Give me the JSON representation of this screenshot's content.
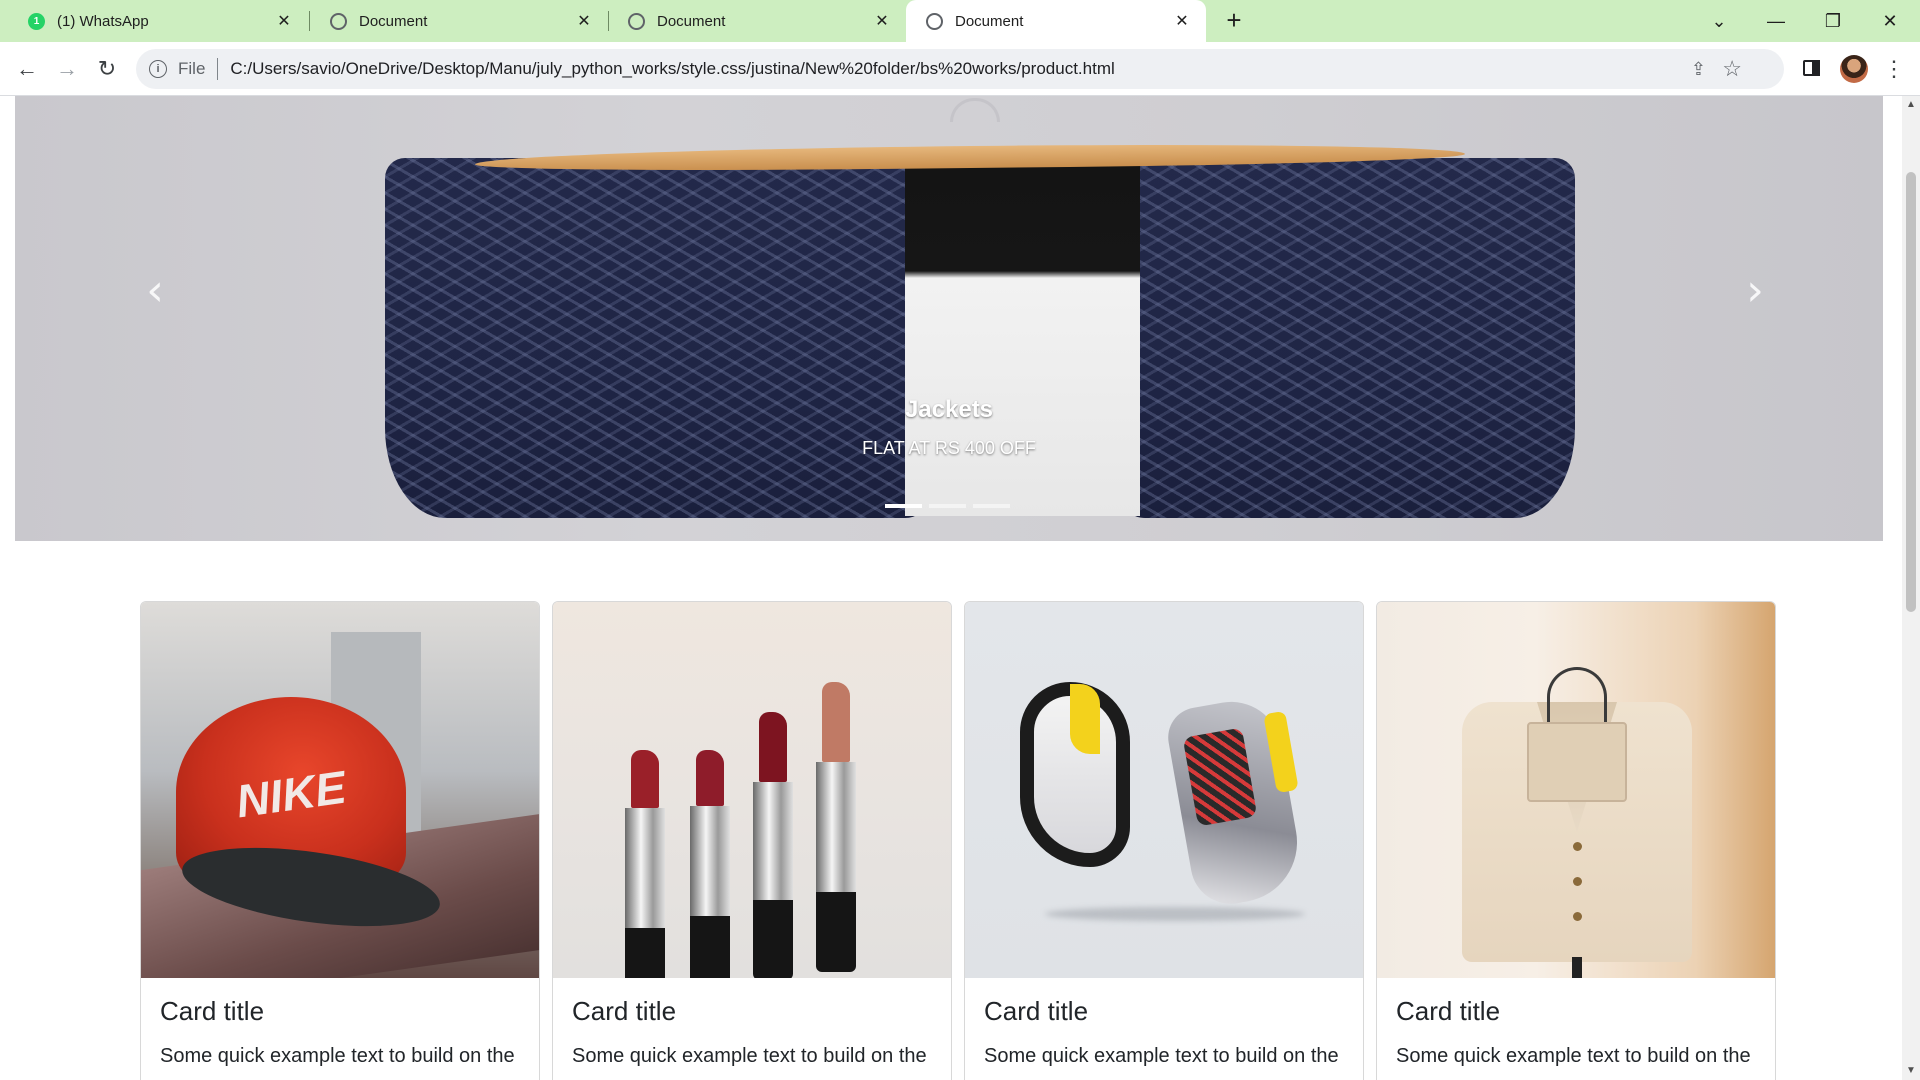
{
  "browser": {
    "tabs": [
      {
        "title": "(1) WhatsApp",
        "favicon": "whatsapp-icon",
        "badge": "1",
        "active": false
      },
      {
        "title": "Document",
        "favicon": "globe-icon",
        "active": false
      },
      {
        "title": "Document",
        "favicon": "globe-icon",
        "active": false
      },
      {
        "title": "Document",
        "favicon": "globe-icon",
        "active": true
      }
    ],
    "new_tab": "+",
    "window_controls": {
      "dropdown": "⌄",
      "minimize": "—",
      "restore": "❐",
      "close": "✕"
    },
    "nav": {
      "back": "←",
      "forward": "→",
      "reload": "↻"
    },
    "omnibox": {
      "info_icon": "i",
      "scheme": "File",
      "url": "C:/Users/savio/OneDrive/Desktop/Manu/july_python_works/style.css/justina/New%20folder/bs%20works/product.html"
    },
    "colors": {
      "tabstrip": "#cdeec0",
      "omnibox": "#eef0f3"
    }
  },
  "page": {
    "carousel": {
      "caption_title": "Jackets",
      "caption_text": "FLAT AT RS 400 OFF",
      "slide_count": 3,
      "active_slide": 0,
      "prev_icon": "‹",
      "next_icon": "›"
    },
    "cards": [
      {
        "image": "red-nike-cap",
        "logo_text": "NIKE",
        "title": "Card title",
        "text": "Some quick example text to build on the"
      },
      {
        "image": "lipsticks",
        "title": "Card title",
        "text": "Some quick example text to build on the"
      },
      {
        "image": "sneakers",
        "title": "Card title",
        "text": "Some quick example text to build on the"
      },
      {
        "image": "blazer-on-hanger",
        "title": "Card title",
        "text": "Some quick example text to build on the"
      }
    ]
  }
}
